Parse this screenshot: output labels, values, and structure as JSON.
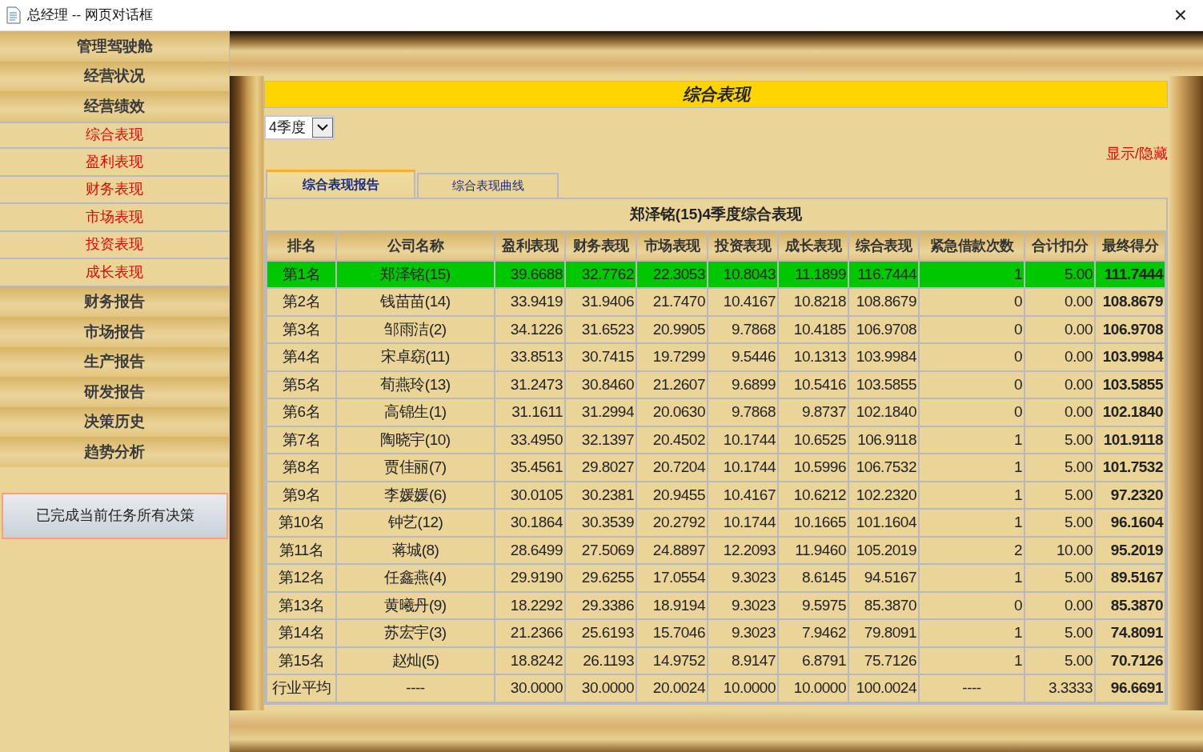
{
  "window": {
    "title": "总经理 -- 网页对话框",
    "close": "×"
  },
  "sidebar": {
    "items": [
      {
        "kind": "header",
        "label": "管理驾驶舱"
      },
      {
        "kind": "header",
        "label": "经营状况"
      },
      {
        "kind": "header",
        "label": "经营绩效"
      },
      {
        "kind": "link",
        "label": "综合表现"
      },
      {
        "kind": "link",
        "label": "盈利表现"
      },
      {
        "kind": "link",
        "label": "财务表现"
      },
      {
        "kind": "link",
        "label": "市场表现"
      },
      {
        "kind": "link",
        "label": "投资表现"
      },
      {
        "kind": "link",
        "label": "成长表现"
      },
      {
        "kind": "header",
        "label": "财务报告"
      },
      {
        "kind": "header",
        "label": "市场报告"
      },
      {
        "kind": "header",
        "label": "生产报告"
      },
      {
        "kind": "header",
        "label": "研发报告"
      },
      {
        "kind": "header",
        "label": "决策历史"
      },
      {
        "kind": "header",
        "label": "趋势分析"
      }
    ],
    "button": "已完成当前任务所有决策"
  },
  "banner": {
    "title": "综合表现"
  },
  "quarter_select": {
    "value": "4季度"
  },
  "toggle_link": "显示/隐藏",
  "tabs": [
    {
      "label": "综合表现报告",
      "selected": true
    },
    {
      "label": "综合表现曲线",
      "selected": false
    }
  ],
  "table": {
    "caption": "郑泽铭(15)4季度综合表现",
    "columns": [
      "排名",
      "公司名称",
      "盈利表现",
      "财务表现",
      "市场表现",
      "投资表现",
      "成长表现",
      "综合表现",
      "紧急借款次数",
      "合计扣分",
      "最终得分"
    ],
    "rows": [
      {
        "highlighted": true,
        "cells": [
          "第1名",
          "郑泽铭(15)",
          "39.6688",
          "32.7762",
          "22.3053",
          "10.8043",
          "11.1899",
          "116.7444",
          "1",
          "5.00",
          "111.7444"
        ]
      },
      {
        "highlighted": false,
        "cells": [
          "第2名",
          "钱苗苗(14)",
          "33.9419",
          "31.9406",
          "21.7470",
          "10.4167",
          "10.8218",
          "108.8679",
          "0",
          "0.00",
          "108.8679"
        ]
      },
      {
        "highlighted": false,
        "cells": [
          "第3名",
          "邹雨洁(2)",
          "34.1226",
          "31.6523",
          "20.9905",
          "9.7868",
          "10.4185",
          "106.9708",
          "0",
          "0.00",
          "106.9708"
        ]
      },
      {
        "highlighted": false,
        "cells": [
          "第4名",
          "宋卓窈(11)",
          "33.8513",
          "30.7415",
          "19.7299",
          "9.5446",
          "10.1313",
          "103.9984",
          "0",
          "0.00",
          "103.9984"
        ]
      },
      {
        "highlighted": false,
        "cells": [
          "第5名",
          "荀燕玲(13)",
          "31.2473",
          "30.8460",
          "21.2607",
          "9.6899",
          "10.5416",
          "103.5855",
          "0",
          "0.00",
          "103.5855"
        ]
      },
      {
        "highlighted": false,
        "cells": [
          "第6名",
          "高锦生(1)",
          "31.1611",
          "31.2994",
          "20.0630",
          "9.7868",
          "9.8737",
          "102.1840",
          "0",
          "0.00",
          "102.1840"
        ]
      },
      {
        "highlighted": false,
        "cells": [
          "第7名",
          "陶晓宇(10)",
          "33.4950",
          "32.1397",
          "20.4502",
          "10.1744",
          "10.6525",
          "106.9118",
          "1",
          "5.00",
          "101.9118"
        ]
      },
      {
        "highlighted": false,
        "cells": [
          "第8名",
          "贾佳丽(7)",
          "35.4561",
          "29.8027",
          "20.7204",
          "10.1744",
          "10.5996",
          "106.7532",
          "1",
          "5.00",
          "101.7532"
        ]
      },
      {
        "highlighted": false,
        "cells": [
          "第9名",
          "李媛媛(6)",
          "30.0105",
          "30.2381",
          "20.9455",
          "10.4167",
          "10.6212",
          "102.2320",
          "1",
          "5.00",
          "97.2320"
        ]
      },
      {
        "highlighted": false,
        "cells": [
          "第10名",
          "钟艺(12)",
          "30.1864",
          "30.3539",
          "20.2792",
          "10.1744",
          "10.1665",
          "101.1604",
          "1",
          "5.00",
          "96.1604"
        ]
      },
      {
        "highlighted": false,
        "cells": [
          "第11名",
          "蒋城(8)",
          "28.6499",
          "27.5069",
          "24.8897",
          "12.2093",
          "11.9460",
          "105.2019",
          "2",
          "10.00",
          "95.2019"
        ]
      },
      {
        "highlighted": false,
        "cells": [
          "第12名",
          "任鑫燕(4)",
          "29.9190",
          "29.6255",
          "17.0554",
          "9.3023",
          "8.6145",
          "94.5167",
          "1",
          "5.00",
          "89.5167"
        ]
      },
      {
        "highlighted": false,
        "cells": [
          "第13名",
          "黄曦丹(9)",
          "18.2292",
          "29.3386",
          "18.9194",
          "9.3023",
          "9.5975",
          "85.3870",
          "0",
          "0.00",
          "85.3870"
        ]
      },
      {
        "highlighted": false,
        "cells": [
          "第14名",
          "苏宏宇(3)",
          "21.2366",
          "25.6193",
          "15.7046",
          "9.3023",
          "7.9462",
          "79.8091",
          "1",
          "5.00",
          "74.8091"
        ]
      },
      {
        "highlighted": false,
        "cells": [
          "第15名",
          "赵灿(5)",
          "18.8242",
          "26.1193",
          "14.9752",
          "8.9147",
          "6.8791",
          "75.7126",
          "1",
          "5.00",
          "70.7126"
        ]
      },
      {
        "highlighted": false,
        "cells": [
          "行业平均",
          "----",
          "30.0000",
          "30.0000",
          "20.0024",
          "10.0000",
          "10.0000",
          "100.0024",
          "----",
          "3.3333",
          "96.6691"
        ]
      }
    ]
  }
}
